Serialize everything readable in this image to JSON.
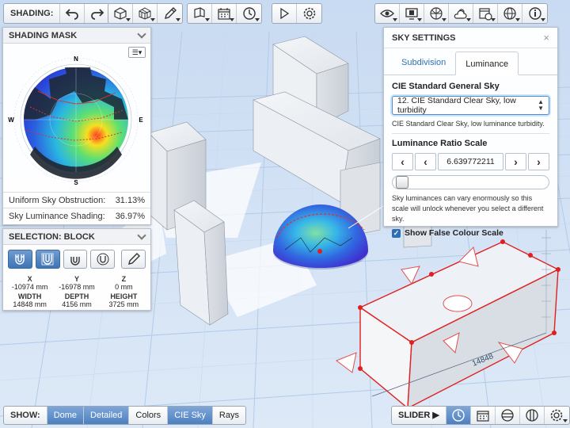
{
  "toolbar": {
    "shading_label": "SHADING:"
  },
  "shading_panel": {
    "title": "SHADING MASK",
    "compass": {
      "north": "N",
      "south": "S",
      "east": "E",
      "west": "W"
    },
    "stats": [
      {
        "label": "Uniform Sky Obstruction:",
        "value": "31.13%"
      },
      {
        "label": "Sky Luminance Shading:",
        "value": "36.97%"
      }
    ]
  },
  "selection_panel": {
    "title": "SELECTION: BLOCK",
    "fields": [
      {
        "label": "X",
        "value": "-10974 mm"
      },
      {
        "label": "Y",
        "value": "-16978 mm"
      },
      {
        "label": "Z",
        "value": "0 mm"
      },
      {
        "label": "WIDTH",
        "value": "14848 mm"
      },
      {
        "label": "DEPTH",
        "value": "4156 mm"
      },
      {
        "label": "HEIGHT",
        "value": "3725 mm"
      }
    ]
  },
  "sky_panel": {
    "title": "SKY SETTINGS",
    "close": "×",
    "tabs": [
      "Subdivision",
      "Luminance"
    ],
    "active_tab": "Luminance",
    "sky_heading": "CIE Standard General Sky",
    "sky_selected": "12. CIE Standard Clear Sky, low turbidity",
    "sky_description": "CIE Standard Clear Sky, low luminance turbidity.",
    "ratio_heading": "Luminance Ratio Scale",
    "ratio_value": "6.639772211",
    "ratio_level": 0.02,
    "ratio_help": "Sky luminances can vary enormously so this scale will unlock whenever you select a different sky.",
    "false_colour_label": "Show False Colour Scale",
    "false_colour_checked": true
  },
  "bottom_bar": {
    "show_label": "SHOW:",
    "buttons": [
      {
        "label": "Dome",
        "active": true
      },
      {
        "label": "Detailed",
        "active": true
      },
      {
        "label": "Colors",
        "active": false
      },
      {
        "label": "CIE Sky",
        "active": true
      },
      {
        "label": "Rays",
        "active": false
      }
    ],
    "slider_label": "SLIDER"
  },
  "viewport": {
    "dimension_label": "14848"
  },
  "colors": {
    "accent": "#3f74b6",
    "selection": "#e02020",
    "grid": "#a8c4e8"
  }
}
